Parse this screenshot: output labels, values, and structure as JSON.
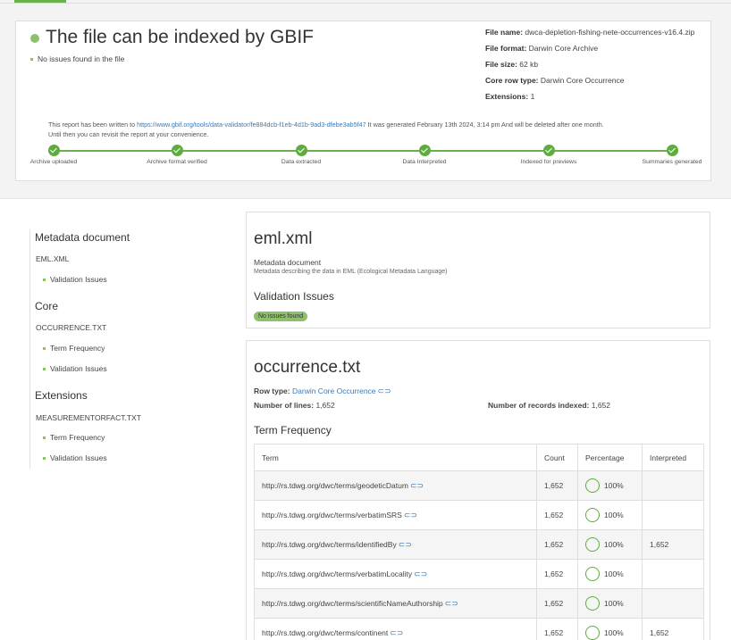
{
  "summary": {
    "title": "The file can be indexed by GBIF",
    "no_issues": "No issues found in the file",
    "file_name_label": "File name:",
    "file_name": "dwca-depletion-fishing-nete-occurrences-v16.4.zip",
    "file_format_label": "File format:",
    "file_format": "Darwin Core Archive",
    "file_size_label": "File size:",
    "file_size": "62 kb",
    "core_row_type_label": "Core row type:",
    "core_row_type": "Darwin Core Occurrence",
    "extensions_label": "Extensions:",
    "extensions": "1",
    "report_prefix": "This report has been written to",
    "report_url": "https://www.gbif.org/tools/data-validator/fe884dcb-f1eb-4d1b-9ad3-dfebe3ab5f47",
    "report_suffix": "It was generated February 13th 2024, 3:14 pm And will be deleted after one month.",
    "report_line2": "Until then you can revisit the report at your convenience.",
    "steps": [
      "Archive uploaded",
      "Archive format verified",
      "Data extracted",
      "Data Interpreted",
      "Indexed for previews",
      "Summaries generated"
    ]
  },
  "nav": {
    "metadata_heading": "Metadata document",
    "eml_file": "EML.XML",
    "eml_validation": "Validation Issues",
    "core_heading": "Core",
    "occ_file": "OCCURRENCE.TXT",
    "occ_term_freq": "Term Frequency",
    "occ_validation": "Validation Issues",
    "ext_heading": "Extensions",
    "mof_file": "MEASUREMENTORFACT.TXT",
    "mof_term_freq": "Term Frequency",
    "mof_validation": "Validation Issues"
  },
  "eml": {
    "title": "eml.xml",
    "subtitle": "Metadata document",
    "description": "Metadata describing the data in EML (Ecological Metadata Language)",
    "validation_heading": "Validation Issues",
    "badge": "No issues found"
  },
  "occurrence": {
    "title": "occurrence.txt",
    "row_type_label": "Row type:",
    "row_type": "Darwin Core Occurrence",
    "lines_label": "Number of lines:",
    "lines": "1,652",
    "records_label": "Number of records indexed:",
    "records": "1,652",
    "term_freq_heading": "Term Frequency",
    "table": {
      "headers": [
        "Term",
        "Count",
        "Percentage",
        "Interpreted"
      ],
      "rows": [
        {
          "term": "http://rs.tdwg.org/dwc/terms/geodeticDatum",
          "count": "1,652",
          "percentage": "100%",
          "interpreted": ""
        },
        {
          "term": "http://rs.tdwg.org/dwc/terms/verbatimSRS",
          "count": "1,652",
          "percentage": "100%",
          "interpreted": ""
        },
        {
          "term": "http://rs.tdwg.org/dwc/terms/identifiedBy",
          "count": "1,652",
          "percentage": "100%",
          "interpreted": "1,652"
        },
        {
          "term": "http://rs.tdwg.org/dwc/terms/verbatimLocality",
          "count": "1,652",
          "percentage": "100%",
          "interpreted": ""
        },
        {
          "term": "http://rs.tdwg.org/dwc/terms/scientificNameAuthorship",
          "count": "1,652",
          "percentage": "100%",
          "interpreted": ""
        },
        {
          "term": "http://rs.tdwg.org/dwc/terms/continent",
          "count": "1,652",
          "percentage": "100%",
          "interpreted": "1,652"
        }
      ]
    }
  },
  "colors": {
    "accent_green": "#6ab04c",
    "link_blue": "#3a7ab7"
  }
}
